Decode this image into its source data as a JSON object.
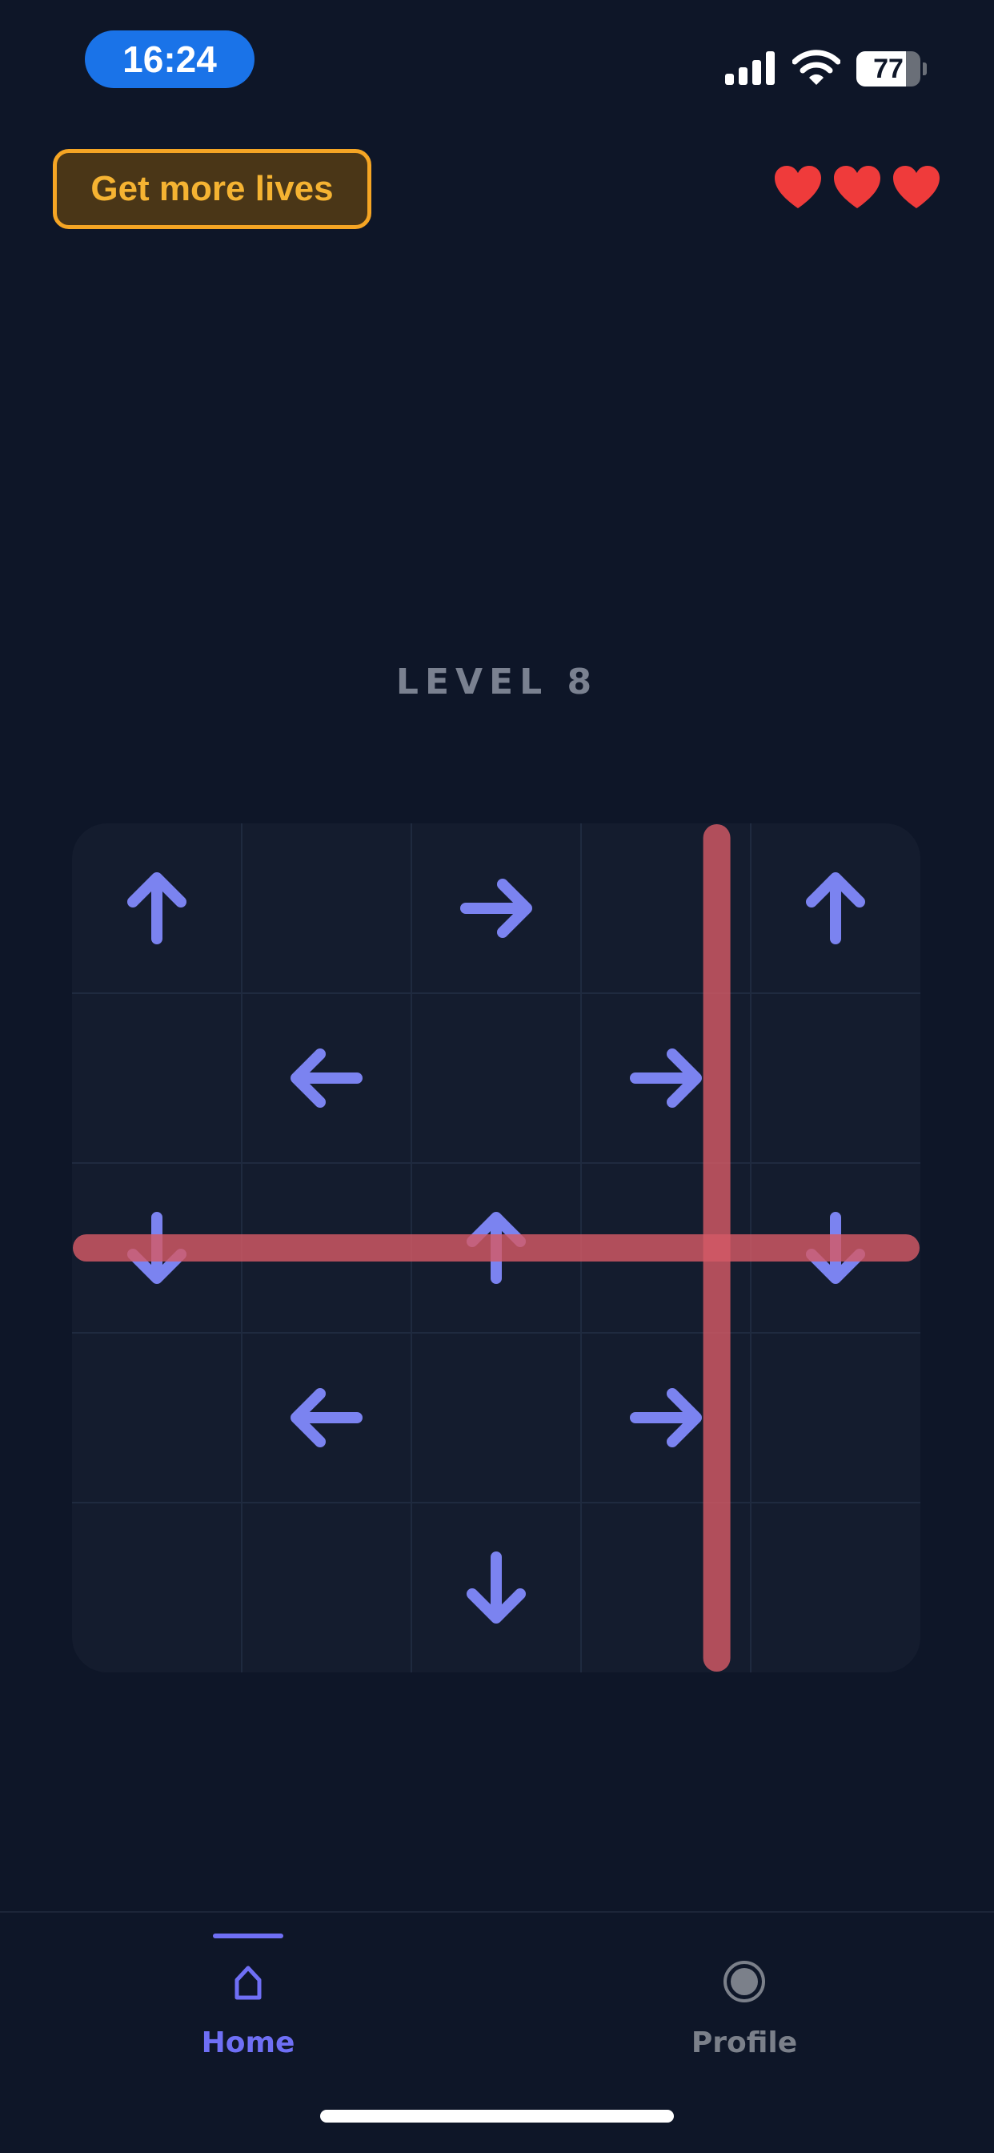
{
  "status_bar": {
    "time": "16:24",
    "battery_percent": 77,
    "battery_label": "77",
    "signal_bars": 4,
    "icons": [
      "signal-icon",
      "wifi-icon",
      "battery-icon"
    ]
  },
  "header": {
    "lives_button_label": "Get more lives",
    "lives_remaining": 3,
    "heart_icon": "heart-icon"
  },
  "level": {
    "title": "LEVEL 8"
  },
  "board": {
    "rows": 5,
    "cols": 5,
    "cells": [
      [
        "up",
        "",
        "right",
        "",
        "up"
      ],
      [
        "",
        "left",
        "",
        "right",
        ""
      ],
      [
        "down",
        "",
        "up",
        "",
        "down"
      ],
      [
        "",
        "left",
        "",
        "right",
        ""
      ],
      [
        "",
        "",
        "down",
        "",
        ""
      ]
    ],
    "blocked_lines": [
      {
        "orientation": "horizontal",
        "index": 2.5
      },
      {
        "orientation": "vertical",
        "index": 3.8
      }
    ],
    "colors": {
      "background": "#141c2e",
      "grid": "#1f2a3f",
      "arrow": "#7b83f0",
      "line": "#d45a66"
    }
  },
  "tabs": [
    {
      "label": "Home",
      "icon": "home-icon",
      "active": true
    },
    {
      "label": "Profile",
      "icon": "profile-icon",
      "active": false
    }
  ],
  "colors": {
    "page_background": "#0e1628",
    "accent": "#6f6ff5",
    "button_border": "#f5a524",
    "heart": "#ef3b3b"
  }
}
